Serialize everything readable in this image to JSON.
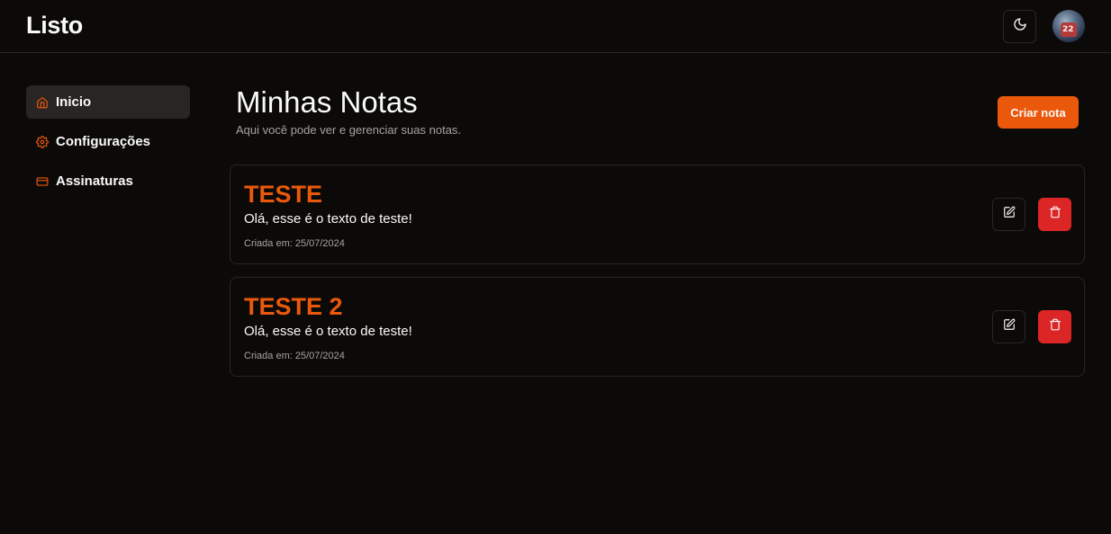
{
  "app": {
    "name": "Listo"
  },
  "header": {
    "theme_toggle_icon": "moon-icon",
    "avatar_icon": "user-avatar",
    "avatar_text": "22"
  },
  "sidebar": {
    "items": [
      {
        "label": "Inicio",
        "icon": "home-icon",
        "active": true
      },
      {
        "label": "Configurações",
        "icon": "gear-icon",
        "active": false
      },
      {
        "label": "Assinaturas",
        "icon": "credit-card-icon",
        "active": false
      }
    ]
  },
  "main": {
    "title": "Minhas Notas",
    "subtitle": "Aqui você pode ver e gerenciar suas notas.",
    "create_button": "Criar nota",
    "notes": [
      {
        "title": "TESTE",
        "text": "Olá, esse é o texto de teste!",
        "date": "Criada em: 25/07/2024"
      },
      {
        "title": "TESTE 2",
        "text": "Olá, esse é o texto de teste!",
        "date": "Criada em: 25/07/2024"
      }
    ]
  },
  "colors": {
    "background": "#0c0a09",
    "accent": "#ea580c",
    "danger": "#dc2626",
    "border": "#292524",
    "muted_text": "#a8a29e"
  }
}
